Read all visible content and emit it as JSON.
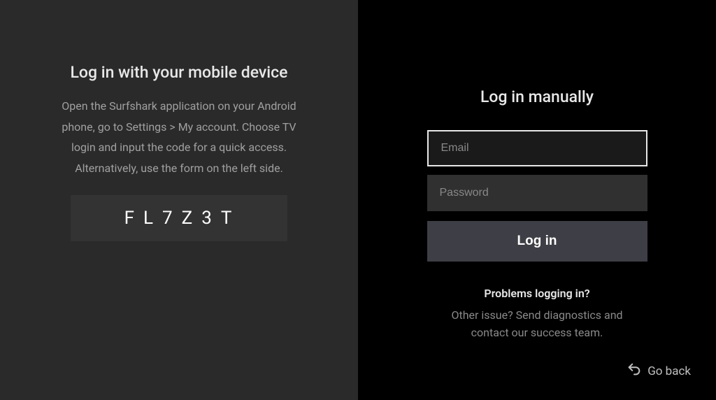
{
  "left": {
    "title": "Log in with your mobile device",
    "description": "Open the Surfshark application on your Android phone, go to Settings > My account. Choose TV login and input the code for a quick access. Alternatively, use the form on the left side.",
    "code": "FL7Z3T"
  },
  "right": {
    "title": "Log in manually",
    "email_placeholder": "Email",
    "password_placeholder": "Password",
    "login_label": "Log in",
    "problems_label": "Problems logging in?",
    "help_text": "Other issue? Send diagnostics and contact our success team.",
    "go_back_label": "Go back"
  }
}
